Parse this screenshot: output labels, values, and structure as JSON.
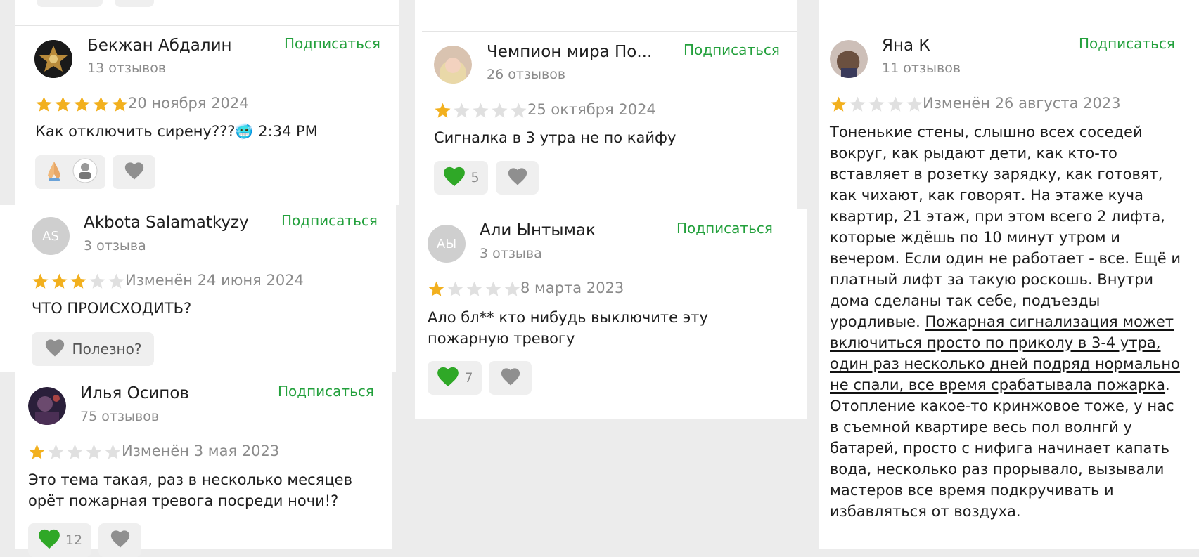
{
  "reviews": [
    {
      "name": "Бекжан Абдалин",
      "count": "13 отзывов",
      "subscribe": "Подписаться",
      "rating": 5,
      "date": "20 ноября 2024",
      "text": "Как отключить сирену???🥶 2:34 PM"
    },
    {
      "name": "Akbota Salamatkyzy",
      "initials": "AS",
      "count": "3 отзыва",
      "subscribe": "Подписаться",
      "rating": 3,
      "date": "Изменён 24 июня 2024",
      "text": "ЧТО ПРОИСХОДИТЬ?",
      "useful": "Полезно?"
    },
    {
      "name": "Илья Осипов",
      "count": "75 отзывов",
      "subscribe": "Подписаться",
      "rating": 1,
      "date": "Изменён 3 мая 2023",
      "text": "Это тема такая, раз в несколько месяцев орёт пожарная тревога посреди ночи!?",
      "likes": "12"
    },
    {
      "name": "Чемпион мира По...",
      "count": "26 отзывов",
      "subscribe": "Подписаться",
      "rating": 1,
      "date": "25 октября 2024",
      "text": "Сигналка в 3 утра не по кайфу",
      "likes": "5"
    },
    {
      "name": "Али Ынтымак",
      "initials": "АЫ",
      "count": "3 отзыва",
      "subscribe": "Подписаться",
      "rating": 1,
      "date": "8 марта 2023",
      "text": "Ало бл** кто нибудь выключите эту пожарную тревогу",
      "likes": "7"
    },
    {
      "name": "Яна К",
      "count": "11 отзывов",
      "subscribe": "Подписаться",
      "rating": 1,
      "date": "Изменён 26 августа 2023",
      "text_before": "Тоненькие стены, слышно всех соседей вокруг, как рыдают дети, как кто-то вставляет в розетку зарядку, как готовят, как чихают, как говорят. На этаже куча квартир, 21 этаж, при этом всего 2 лифта, которые ждёшь по 10 минут утром и вечером. Если один не работает - все. Ещё и платный лифт за такую роскошь. Внутри дома сделаны так себе, подъезды уродливые. ",
      "text_highlight": "Пожарная сигнализация может включиться просто по приколу в 3-4 утра, один раз несколько дней подряд нормально не спали, все время срабатывала пожарка",
      "text_after": ". Отопление какое-то кринжовое тоже, у нас в съемной квартире весь пол волнгй у батарей, просто с нифига начинает капать вода, несколько раз прорывало, вызывали мастеров все время подкручивать и избавляться от воздуха."
    }
  ],
  "colors": {
    "star_filled": "#f2b01e",
    "star_empty": "#e0e0e0",
    "subscribe": "#23a03c",
    "heart_green": "#2fa827",
    "heart_gray": "#8f8f8f"
  },
  "icons": [
    "star-icon",
    "heart-icon",
    "praying-hands-icon",
    "sticker-icon",
    "avatar"
  ]
}
